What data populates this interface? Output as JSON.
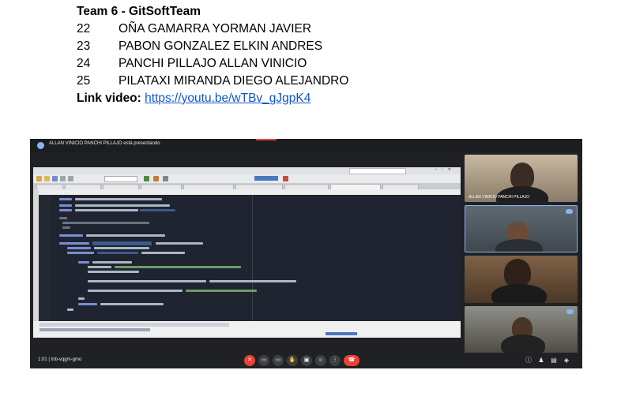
{
  "document": {
    "team_title": "Team 6 - GitSoftTeam",
    "members": [
      {
        "num": "22",
        "name": "OÑA GAMARRA YORMAN JAVIER"
      },
      {
        "num": "23",
        "name": "PABON GONZALEZ ELKIN ANDRES"
      },
      {
        "num": "24",
        "name": "PANCHI PILLAJO ALLAN VINICIO"
      },
      {
        "num": "25",
        "name": "PILATAXI MIRANDA DIEGO ALEJANDRO"
      }
    ],
    "link_label": "Link video:",
    "link_url": "https://youtu.be/wTBv_gJgpK4"
  },
  "meeting": {
    "presenting_label": "ALLAN VINICIO PANCHI PILLAJO está presentando",
    "bottom_info": "1:01 | tnb-vqgm-gmo",
    "participants": [
      {
        "name": "ALLAN VINICIO PANCHI PILLAJO"
      },
      {
        "name": ""
      },
      {
        "name": ""
      },
      {
        "name": ""
      }
    ],
    "colors": {
      "accent": "#8ab4f8",
      "leave": "#ea4335",
      "background": "#202124",
      "link": "#1155cc"
    },
    "controls": [
      "mic-off-icon",
      "camera-icon",
      "captions-icon",
      "hand-icon",
      "present-icon",
      "emoji-icon",
      "more-icon",
      "leave-call-icon"
    ],
    "right_icons": [
      "info-icon",
      "people-icon",
      "chat-icon",
      "activities-icon"
    ]
  }
}
